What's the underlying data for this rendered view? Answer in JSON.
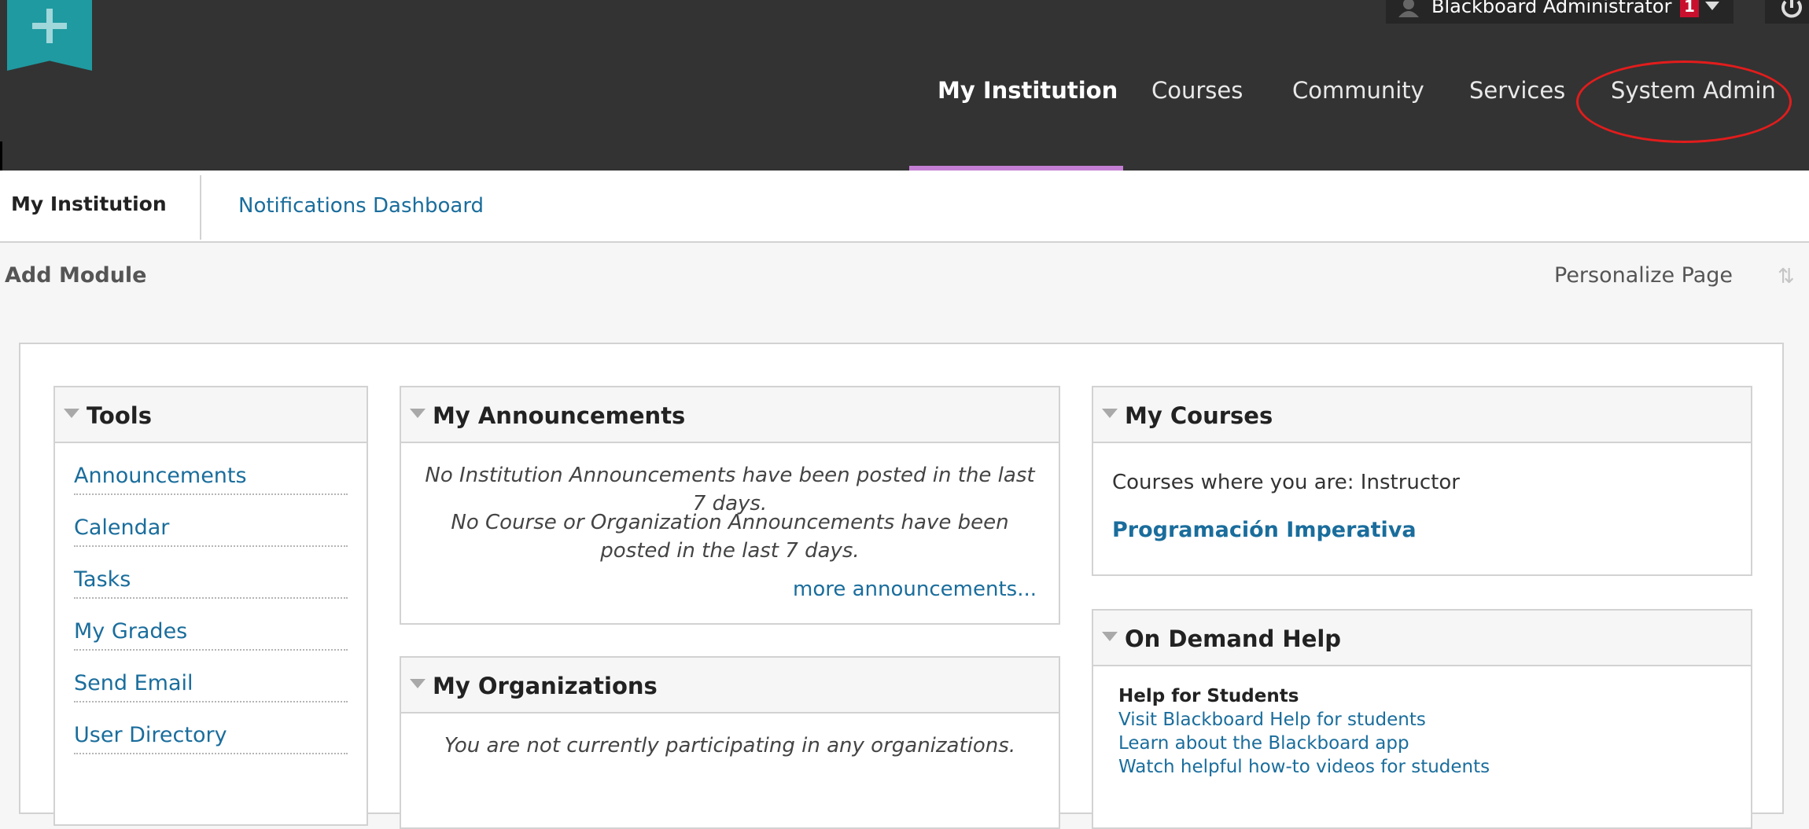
{
  "header": {
    "user_name": "Blackboard Administrator",
    "notification_count": "1",
    "nav_tabs": [
      {
        "label": "My Institution",
        "active": true
      },
      {
        "label": "Courses",
        "active": false
      },
      {
        "label": "Community",
        "active": false
      },
      {
        "label": "Services",
        "active": false
      },
      {
        "label": "System Admin",
        "active": false
      }
    ]
  },
  "subnav": {
    "active": "My Institution",
    "link": "Notifications Dashboard"
  },
  "toolbar": {
    "add_module": "Add Module",
    "personalize": "Personalize Page"
  },
  "tools_module": {
    "title": "Tools",
    "items": [
      "Announcements",
      "Calendar",
      "Tasks",
      "My Grades",
      "Send Email",
      "User Directory"
    ]
  },
  "announcements_module": {
    "title": "My Announcements",
    "msg_institution": "No Institution Announcements have been posted in the last 7 days.",
    "msg_course": "No Course or Organization Announcements have been posted in the last 7 days.",
    "more_link": "more announcements..."
  },
  "organizations_module": {
    "title": "My Organizations",
    "msg": "You are not currently participating in any organizations."
  },
  "courses_module": {
    "title": "My Courses",
    "intro": "Courses where you are: Instructor",
    "course": "Programación Imperativa"
  },
  "help_module": {
    "title": "On Demand Help",
    "heading": "Help for Students",
    "links": [
      "Visit Blackboard Help for students",
      "Learn about the Blackboard app",
      "Watch helpful how-to videos for students"
    ]
  },
  "colors": {
    "header_bg": "#333333",
    "active_tab_bar": "#c47fd5",
    "link": "#1a6d9c",
    "annotation_circle": "#e21c1c"
  }
}
